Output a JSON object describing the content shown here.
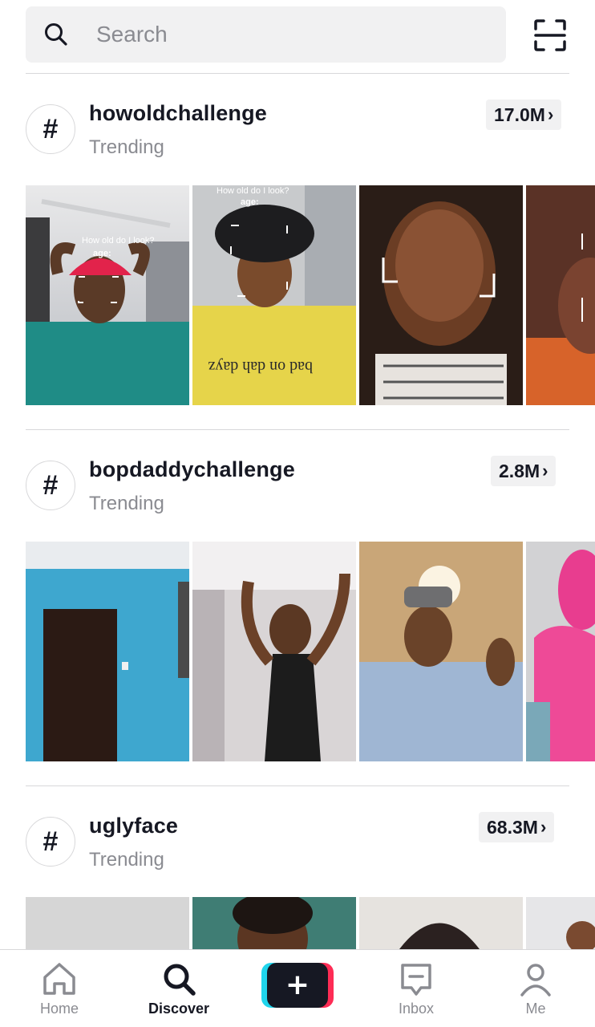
{
  "search": {
    "placeholder": "Search"
  },
  "icons": {
    "search": "search-icon",
    "scan": "scan-icon",
    "hashtag": "hashtag-icon",
    "chevron": "chevron-right-icon"
  },
  "colors": {
    "text_primary": "#161823",
    "text_secondary": "#8a8b91",
    "pill_bg": "#f1f1f2",
    "create_cyan": "#20d5ec",
    "create_red": "#fe2c55"
  },
  "hashtags": [
    {
      "name": "howoldchallenge",
      "subtitle": "Trending",
      "count": "17.0M"
    },
    {
      "name": "bopdaddychallenge",
      "subtitle": "Trending",
      "count": "2.8M"
    },
    {
      "name": "uglyface",
      "subtitle": "Trending",
      "count": "68.3M"
    }
  ],
  "overlays": {
    "howold_1": "How old do I look?",
    "howold_1_age": "age:",
    "howold_2": "How old do I look?",
    "howold_2_age": "age:",
    "shirt_text": "bad on dah dayz"
  },
  "nav": {
    "home": "Home",
    "discover": "Discover",
    "inbox": "Inbox",
    "me": "Me",
    "create_symbol": "+"
  }
}
